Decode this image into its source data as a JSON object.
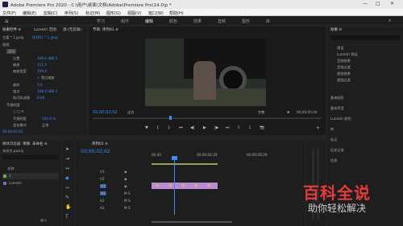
{
  "window": {
    "title": "Adobe Premiere Pro 2020 - C:\\用户\\桌面\\文档\\Adobe\\Premiere Pro\\14.0\\p *"
  },
  "menu": [
    "文件(F)",
    "编辑(E)",
    "剪辑(C)",
    "序列(S)",
    "标记(M)",
    "图形(G)",
    "视图(V)",
    "窗口(W)",
    "帮助(H)"
  ],
  "workspace_tabs": [
    "学习",
    "组件",
    "编辑",
    "颜色",
    "效果",
    "音频",
    "图形",
    "库"
  ],
  "workspace_active": "编辑",
  "effect_controls": {
    "tabs": [
      "效果控件 ≡",
      "Lumetri 范围",
      "源:(无剪辑)"
    ],
    "source_row": [
      "主要 * 1.jpeg",
      "序列01 * 1.jpeg"
    ],
    "section_video": "视频",
    "fx_motion": "运动",
    "rows": [
      {
        "label": "位置",
        "value": "348.0  480.5"
      },
      {
        "label": "缩放",
        "value": "111.5"
      },
      {
        "label": "缩放宽度",
        "value": "100.0"
      },
      {
        "label": "等比缩放",
        "value": "✓ 等比缩放"
      },
      {
        "label": "旋转",
        "value": "0.0"
      },
      {
        "label": "锚点",
        "value": "348.0  480.5"
      },
      {
        "label": "防闪烁滤镜",
        "value": "0.00"
      }
    ],
    "fx_opacity": "不透明度",
    "opacity_rows": [
      {
        "label": "不透明度",
        "value": "100.0 %"
      },
      {
        "label": "混合模式",
        "value": "正常"
      }
    ],
    "timecode": "00;00;02;02"
  },
  "program_monitor": {
    "title": "节目: 序列01 ≡",
    "timecode_left": "00;00;02;02",
    "fit_label": "适合",
    "full_label": "完整",
    "timecode_right": "00;00;05;00"
  },
  "project": {
    "tabs": [
      "项目: 未命名 ≡",
      "媒体浏览器",
      "库"
    ],
    "name_label": "未命名.prproj",
    "column_header": "名称",
    "items": [
      {
        "name": "1",
        "color": "#6ab23e"
      },
      {
        "name": "Lumetri",
        "color": "#8a62c4"
      }
    ]
  },
  "timeline": {
    "title": "序列01 ≡",
    "timecode": "00;00;02;02",
    "ruler": [
      "00;00",
      "00;00;04;29",
      "00;00;09;29"
    ],
    "tracks": [
      {
        "name": "V3",
        "type": "video"
      },
      {
        "name": "V2",
        "type": "video"
      },
      {
        "name": "V1",
        "type": "video"
      },
      {
        "name": "A1",
        "type": "audio"
      },
      {
        "name": "A2",
        "type": "audio"
      },
      {
        "name": "A3",
        "type": "audio"
      }
    ],
    "clip_color": "#b98ad8",
    "playhead_color": "#3b8cf0"
  },
  "effects_panel": {
    "title": "效果 ≡",
    "folders": [
      "预设",
      "Lumetri 预设",
      "音频效果",
      "音频过渡",
      "视频效果",
      "视频过渡"
    ],
    "sections": [
      "基本图形",
      "基本声音",
      "Lumetri 颜色",
      "库",
      "标记",
      "历史记录",
      "信息"
    ]
  },
  "watermark": {
    "line1": "百科全说",
    "line2": "助你轻松解决"
  }
}
